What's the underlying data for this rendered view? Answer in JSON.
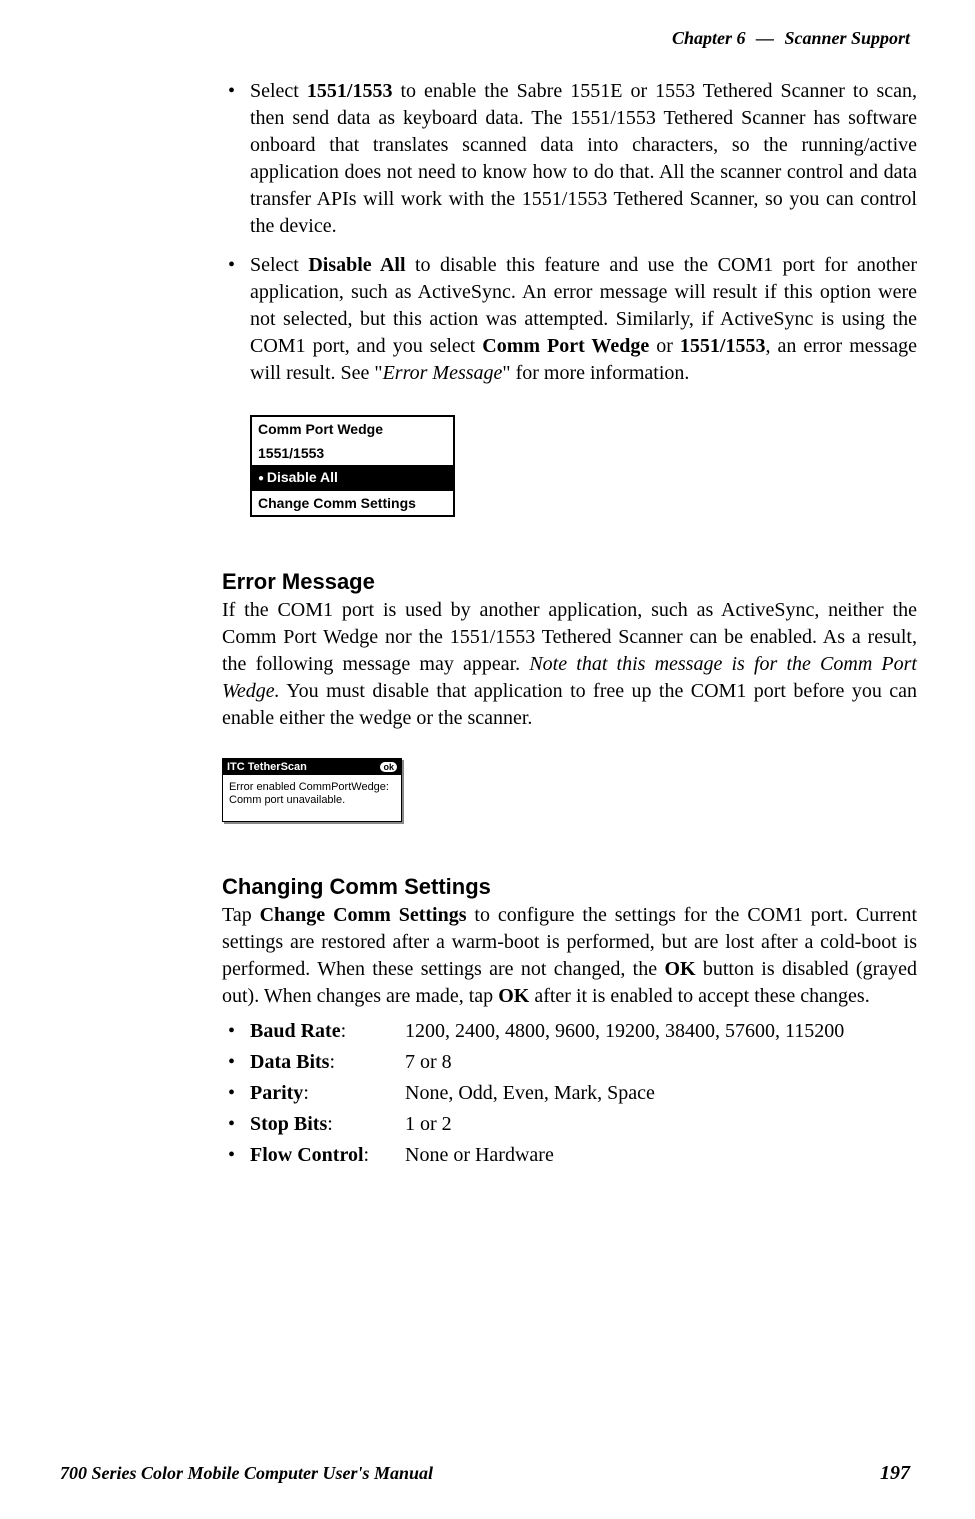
{
  "header": {
    "chapter": "Chapter  6",
    "dash": "—",
    "title": "Scanner Support"
  },
  "bullets": {
    "b1": {
      "pre": "Select ",
      "bold1": "1551/1553",
      "post": " to enable the Sabre 1551E or 1553 Tethered Scanner to scan, then send data as keyboard data. The 1551/1553 Tethered Scanner has software onboard that translates scanned data into characters, so the running/active application does not need to know how to do that. All the scanner control and data transfer APIs will work with the 1551/1553 Tethered Scanner, so you can control the device."
    },
    "b2": {
      "pre": "Select ",
      "bold1": "Disable All",
      "mid1": " to disable this feature and use the COM1 port for another application, such as ActiveSync. An error message will result if this option were not selected, but this action was attempted. Similarly, if ActiveSync is using the COM1 port, and you select ",
      "bold2": "Comm Port Wedge",
      "mid2": " or ",
      "bold3": "1551/1553",
      "mid3": ", an error message will result. See \"",
      "italic1": "Error Message",
      "post": "\" for more information."
    }
  },
  "menu": {
    "row1": "Comm Port Wedge",
    "row2": "1551/1553",
    "row3": "Disable All",
    "row4": "Change Comm Settings"
  },
  "error_heading": "Error Message",
  "error_para": {
    "p1": "If the COM1 port is used by another application, such as ActiveSync, neither the Comm Port Wedge nor the 1551/1553 Tethered Scanner can be enabled. As a result, the following message may appear. ",
    "italic1": "Note that this message is for the Comm Port Wedge.",
    "p2": " You must disable that application to free up the COM1 port before you can enable either the wedge or the scanner."
  },
  "dialog": {
    "title": "ITC TetherScan",
    "ok": "ok",
    "body": "Error enabled CommPortWedge: Comm port unavailable."
  },
  "changing_heading": "Changing Comm Settings",
  "changing_para": {
    "pre": "Tap ",
    "bold1": "Change Comm Settings",
    "mid1": " to configure the settings for the COM1 port. Current settings are restored after a warm-boot is performed, but are lost after a cold-boot is performed. When these settings are not changed, the ",
    "bold2": "OK",
    "mid2": " button is disabled (grayed out). When changes are made, tap ",
    "bold3": "OK",
    "post": " after it is enabled to accept these changes."
  },
  "settings": {
    "baud_label": "Baud Rate",
    "baud_value": "1200, 2400, 4800, 9600, 19200, 38400, 57600, 115200",
    "databits_label": "Data Bits",
    "databits_value": "7 or 8",
    "parity_label": "Parity",
    "parity_value": "None, Odd, Even, Mark, Space",
    "stopbits_label": "Stop Bits",
    "stopbits_value": "1 or 2",
    "flow_label": "Flow Control",
    "flow_value": "None or Hardware"
  },
  "footer": {
    "left": "700 Series Color Mobile Computer User's Manual",
    "right": "197"
  }
}
